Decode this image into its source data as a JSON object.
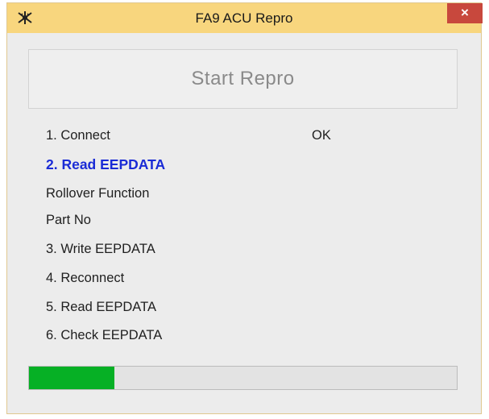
{
  "window": {
    "title": "FA9 ACU Repro",
    "app_icon": "ecu-chip-icon",
    "close_label": "×"
  },
  "start_button": {
    "label": "Start Repro",
    "enabled": false
  },
  "steps": [
    {
      "label": "1. Connect",
      "status": "OK",
      "active": false
    },
    {
      "label": "2. Read EEPDATA",
      "status": "",
      "active": true
    },
    {
      "label": "Rollover Function",
      "status": "",
      "active": false
    },
    {
      "label": "Part No",
      "status": "",
      "active": false
    },
    {
      "label": "3. Write EEPDATA",
      "status": "",
      "active": false
    },
    {
      "label": "4. Reconnect",
      "status": "",
      "active": false
    },
    {
      "label": "5. Read EEPDATA",
      "status": "",
      "active": false
    },
    {
      "label": "6. Check EEPDATA",
      "status": "",
      "active": false
    }
  ],
  "progress": {
    "fraction": 0.2
  },
  "colors": {
    "titlebar": "#f8d67e",
    "close_button": "#c8483d",
    "active_step": "#1a2bd6",
    "progress_fill": "#06b025"
  }
}
